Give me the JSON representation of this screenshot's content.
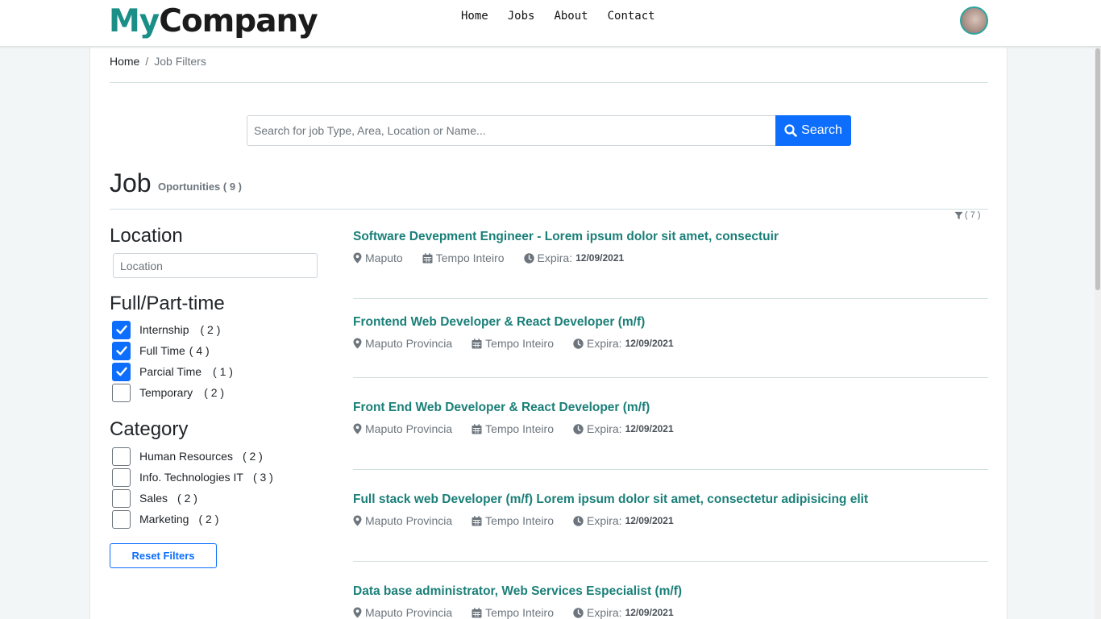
{
  "brand": {
    "part1": "My",
    "part2": "Company"
  },
  "nav": {
    "items": [
      "Home",
      "Jobs",
      "About",
      "Contact"
    ]
  },
  "breadcrumb": {
    "home": "Home",
    "separator": "/",
    "current": "Job Filters"
  },
  "search": {
    "placeholder": "Search for job Type, Area, Location or Name...",
    "button": "Search"
  },
  "heading": {
    "title": "Job",
    "subtitle": "Oportunities ( 9 )"
  },
  "filter_badge": "( 7 )",
  "location": {
    "title": "Location",
    "placeholder": "Location"
  },
  "job_type": {
    "title": "Full/Part-time",
    "items": [
      {
        "label": "Internship",
        "count": "( 2 )",
        "checked": true
      },
      {
        "label": "Full Time",
        "count": "( 4 )",
        "checked": true
      },
      {
        "label": "Parcial Time",
        "count": "( 1 )",
        "checked": true
      },
      {
        "label": "Temporary",
        "count": "( 2 )",
        "checked": false
      }
    ]
  },
  "category": {
    "title": "Category",
    "items": [
      {
        "label": "Human Resources",
        "count": "( 2 )",
        "checked": false
      },
      {
        "label": "Info. Technologies IT",
        "count": "( 3 )",
        "checked": false
      },
      {
        "label": "Sales",
        "count": "( 2 )",
        "checked": false
      },
      {
        "label": "Marketing",
        "count": "( 2 )",
        "checked": false
      }
    ]
  },
  "reset_label": "Reset Filters",
  "expira_label": "Expira:",
  "jobs": [
    {
      "title": "Software Devepment Engineer - Lorem ipsum dolor sit amet, consectuir",
      "location": "Maputo",
      "type": "Tempo Inteiro",
      "expires": "12/09/2021"
    },
    {
      "title": "Frontend Web Developer & React Developer (m/f)",
      "location": "Maputo Provincia",
      "type": "Tempo Inteiro",
      "expires": "12/09/2021"
    },
    {
      "title": "Front End Web Developer & React Developer (m/f)",
      "location": "Maputo Provincia",
      "type": "Tempo Inteiro",
      "expires": "12/09/2021"
    },
    {
      "title": "Full stack web Developer (m/f) Lorem ipsum dolor sit amet, consectetur adipisicing elit",
      "location": "Maputo Provincia",
      "type": "Tempo Inteiro",
      "expires": "12/09/2021"
    },
    {
      "title": "Data base administrator, Web Services Especialist (m/f)",
      "location": "Maputo Provincia",
      "type": "Tempo Inteiro",
      "expires": "12/09/2021"
    }
  ],
  "colors": {
    "brand_teal": "#1a8f87",
    "primary": "#0d6efd",
    "link": "#1a7f78",
    "muted": "#6c757d"
  }
}
